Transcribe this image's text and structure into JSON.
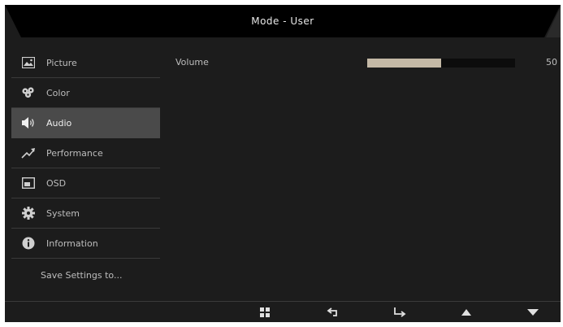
{
  "header": {
    "title": "Mode - User"
  },
  "sidebar": {
    "items": [
      {
        "label": "Picture",
        "icon": "picture-icon",
        "active": false
      },
      {
        "label": "Color",
        "icon": "palette-icon",
        "active": false
      },
      {
        "label": "Audio",
        "icon": "speaker-icon",
        "active": true
      },
      {
        "label": "Performance",
        "icon": "performance-arrow-icon",
        "active": false
      },
      {
        "label": "OSD",
        "icon": "osd-icon",
        "active": false
      },
      {
        "label": "System",
        "icon": "gear-icon",
        "active": false
      },
      {
        "label": "Information",
        "icon": "info-icon",
        "active": false
      }
    ],
    "save_label": "Save Settings to..."
  },
  "content": {
    "settings": [
      {
        "label": "Volume",
        "value": "50",
        "fraction": 0.5
      }
    ]
  },
  "footer": {
    "buttons": [
      "menu-grid-icon",
      "back-arrow-icon",
      "enter-arrow-icon",
      "up-triangle-icon",
      "down-triangle-icon"
    ]
  },
  "colors": {
    "background": "#1c1c1c",
    "active_item": "#4a4a4a",
    "slider_fill": "#c4b9a6",
    "text": "#bdbdbd"
  }
}
